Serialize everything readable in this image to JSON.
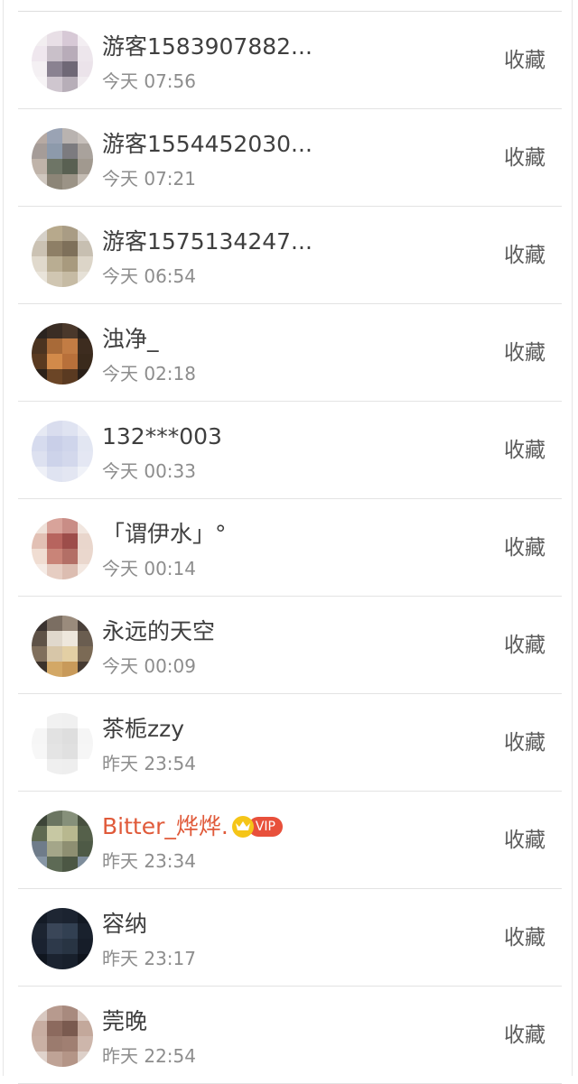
{
  "rows": [
    {
      "name": "游客1583907882...",
      "time": "今天 07:56",
      "action": "收藏",
      "vip": false,
      "avatar": [
        "#f2eef0",
        "#e8dfe6",
        "#d7c9d6",
        "#f3eef2",
        "#efe7ee",
        "#c9c0c9",
        "#b8acb9",
        "#ede6ec",
        "#f4f0f3",
        "#8a8291",
        "#6f6876",
        "#ebe3ea",
        "#f7f4f6",
        "#cfc6cf",
        "#b7aeb8",
        "#f1ecf0"
      ]
    },
    {
      "name": "游客1554452030...",
      "time": "今天 07:21",
      "action": "收藏",
      "vip": false,
      "avatar": [
        "#b7aaa3",
        "#9aa3b4",
        "#b9b3b0",
        "#c7c0bb",
        "#a59c98",
        "#8d9aab",
        "#7c7b7f",
        "#a9a29c",
        "#bfb3a9",
        "#6e7566",
        "#596052",
        "#a1998f",
        "#cfc7bf",
        "#8c8577",
        "#9b9386",
        "#c4bcb3"
      ]
    },
    {
      "name": "游客1575134247...",
      "time": "今天 06:54",
      "action": "收藏",
      "vip": false,
      "avatar": [
        "#d6d1c9",
        "#b7a98c",
        "#a99c84",
        "#d9d4cc",
        "#cbc2b3",
        "#8e7f66",
        "#7e705a",
        "#c7bfb1",
        "#e0d9cc",
        "#b9ad92",
        "#a89a7e",
        "#dcd5c8",
        "#e9e4da",
        "#d0c6b2",
        "#c6bba4",
        "#e6e1d7"
      ]
    },
    {
      "name": "浊净_",
      "time": "今天 02:18",
      "action": "收藏",
      "vip": false,
      "avatar": [
        "#2b2420",
        "#3a2d24",
        "#4a382b",
        "#2a221c",
        "#4b3320",
        "#a86a38",
        "#c27c44",
        "#3d2c1f",
        "#5a3a20",
        "#d28a4a",
        "#b8703a",
        "#3a2a1c",
        "#2c221a",
        "#6b4526",
        "#5a3a21",
        "#2a2019"
      ]
    },
    {
      "name": "132***003",
      "time": "今天 00:33",
      "action": "收藏",
      "vip": false,
      "avatar": [
        "#e6e9f3",
        "#d9ddee",
        "#dfe3f1",
        "#eceef6",
        "#d6dbee",
        "#c9cfe8",
        "#cfd5eb",
        "#e2e6f2",
        "#dde1f0",
        "#cdd3ea",
        "#d3d8ec",
        "#e4e7f3",
        "#eef0f7",
        "#dfe3f1",
        "#e3e6f2",
        "#f0f2f8"
      ]
    },
    {
      "name": "「谓伊水」°",
      "time": "今天 00:14",
      "action": "收藏",
      "vip": false,
      "avatar": [
        "#efe1d9",
        "#d8a39a",
        "#c98d86",
        "#f1e6df",
        "#e2c0b4",
        "#b7645e",
        "#9d4d4a",
        "#e9d6cc",
        "#f0ddd2",
        "#c98478",
        "#b36f66",
        "#ead7cd",
        "#f5ebe5",
        "#e6cdc2",
        "#dcbdb1",
        "#f3e8e1"
      ]
    },
    {
      "name": "永远的天空",
      "time": "今天 00:09",
      "action": "收藏",
      "vip": false,
      "avatar": [
        "#3a3330",
        "#7b6e62",
        "#9a8b7c",
        "#4a403a",
        "#5e5247",
        "#e0d8cc",
        "#eee7dc",
        "#6a5d50",
        "#806f5c",
        "#d7c6a8",
        "#e3cfa4",
        "#7b6a55",
        "#3b322b",
        "#d3a866",
        "#c89a5a",
        "#453a31"
      ]
    },
    {
      "name": "茶栀zzy",
      "time": "昨天 23:54",
      "action": "收藏",
      "vip": false,
      "avatar": [
        "#ffffff",
        "#f1f1f1",
        "#f0f0f0",
        "#ffffff",
        "#f6f6f6",
        "#e2e2e2",
        "#dedede",
        "#f5f5f5",
        "#f7f7f7",
        "#e4e4e4",
        "#e0e0e0",
        "#f6f6f6",
        "#ffffff",
        "#efefef",
        "#eeeeee",
        "#ffffff"
      ]
    },
    {
      "name": "Bitter_烨烨.",
      "time": "昨天 23:34",
      "action": "收藏",
      "vip": true,
      "vip_label": "VIP",
      "avatar": [
        "#3d4538",
        "#6b7561",
        "#86907a",
        "#48503f",
        "#5f6a52",
        "#c7c8a3",
        "#b8b88f",
        "#55604a",
        "#6f7c8a",
        "#a4a689",
        "#8e8f72",
        "#4e5a46",
        "#8796a5",
        "#5d6a55",
        "#4c5744",
        "#7e8d9b"
      ]
    },
    {
      "name": "容纳",
      "time": "昨天 23:17",
      "action": "收藏",
      "vip": false,
      "avatar": [
        "#141b26",
        "#1e2633",
        "#1b2330",
        "#121923",
        "#1c2431",
        "#3a4658",
        "#324052",
        "#19212d",
        "#1a2230",
        "#2d394a",
        "#283443",
        "#161d29",
        "#10161f",
        "#1b2330",
        "#18202c",
        "#0f141d"
      ]
    },
    {
      "name": "莞晚",
      "time": "昨天 22:54",
      "action": "收藏",
      "vip": false,
      "avatar": [
        "#d8c8c0",
        "#b79a8e",
        "#a88a7e",
        "#dccdc5",
        "#c7ada1",
        "#8c6a5e",
        "#7a5a4f",
        "#c3a89b",
        "#c9b0a4",
        "#9b7b6e",
        "#a07f72",
        "#cdb6ab",
        "#e0d3cc",
        "#bfa396",
        "#b49587",
        "#ddd0c9"
      ]
    }
  ]
}
